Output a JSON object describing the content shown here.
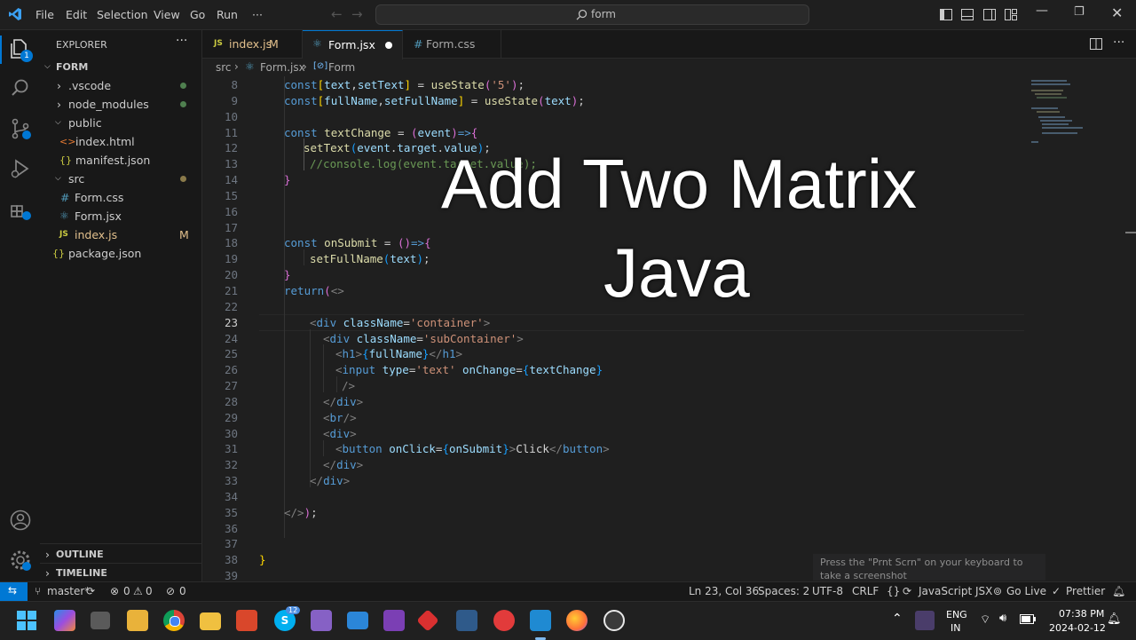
{
  "titlebar": {
    "menu": [
      "File",
      "Edit",
      "Selection",
      "View",
      "Go",
      "Run",
      "···"
    ],
    "search": "form"
  },
  "explorer": {
    "header": "EXPLORER",
    "project": "FORM",
    "items": [
      {
        "label": ".vscode",
        "kind": "folder"
      },
      {
        "label": "node_modules",
        "kind": "folder"
      },
      {
        "label": "public",
        "kind": "folder-open"
      },
      {
        "label": "index.html",
        "kind": "html"
      },
      {
        "label": "manifest.json",
        "kind": "json"
      },
      {
        "label": "src",
        "kind": "folder-open"
      },
      {
        "label": "Form.css",
        "kind": "css"
      },
      {
        "label": "Form.jsx",
        "kind": "jsx"
      },
      {
        "label": "index.js",
        "kind": "js",
        "badge": "M"
      },
      {
        "label": "package.json",
        "kind": "json"
      }
    ],
    "outline": "OUTLINE",
    "timeline": "TIMELINE"
  },
  "tabs": [
    {
      "label": "index.js",
      "badge": "M",
      "icon": "JS"
    },
    {
      "label": "Form.jsx",
      "active": true
    },
    {
      "label": "Form.css",
      "icon": "#"
    }
  ],
  "breadcrumb": {
    "src": "src",
    "file": "Form.jsx",
    "symbol": "Form"
  },
  "editor": {
    "line_numbers": [
      "8",
      "9",
      "10",
      "11",
      "12",
      "13",
      "14",
      "15",
      "16",
      "17",
      "18",
      "19",
      "20",
      "21",
      "22",
      "23",
      "24",
      "25",
      "26",
      "27",
      "28",
      "29",
      "30",
      "31",
      "32",
      "33",
      "34",
      "35",
      "36",
      "37",
      "38",
      "39"
    ],
    "current_line": "23"
  },
  "overlay": {
    "line1": "Add Two Matrix",
    "line2": "Java"
  },
  "toast": "Press the \"Prnt Scrn\" on your keyboard to take a screenshot",
  "statusbar": {
    "branch": "master*",
    "errors": "0",
    "warnings": "0",
    "ports": "0",
    "cursor": "Ln 23, Col 36",
    "spaces": "Spaces: 2",
    "encoding": "UTF-8",
    "eol": "CRLF",
    "language": "JavaScript JSX",
    "golive": "Go Live",
    "prettier": "Prettier"
  },
  "taskbar": {
    "lang1": "ENG",
    "lang2": "IN",
    "time": "07:38 PM",
    "date": "2024-02-12",
    "skype_badge": "12"
  },
  "colors": {
    "accent": "#0078d4",
    "background": "#1f1f1f",
    "sidebar": "#181818"
  }
}
